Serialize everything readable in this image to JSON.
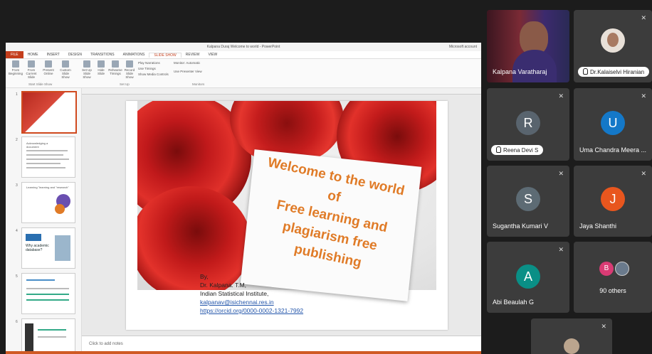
{
  "powerpoint": {
    "window_title": "Kalpana Duraj Welcome to world - PowerPoint",
    "account": "Microsoft account",
    "tabs": [
      "FILE",
      "HOME",
      "INSERT",
      "DESIGN",
      "TRANSITIONS",
      "ANIMATIONS",
      "SLIDE SHOW",
      "REVIEW",
      "VIEW"
    ],
    "ribbon": {
      "from_beginning": "From Beginning",
      "from_current": "From Current Slide",
      "present_online": "Present Online",
      "custom_show": "Custom Slide Show",
      "setup_show": "Set Up Slide Show",
      "hide_slide": "Hide Slide",
      "rehearse": "Rehearse Timings",
      "record": "Record Slide Show",
      "play_narrations": "Play Narrations",
      "use_timings": "Use Timings",
      "show_media": "Show Media Controls",
      "monitor": "Monitor: Automatic",
      "presenter_view": "Use Presenter View",
      "group_start": "Start Slide Show",
      "group_setup": "Set Up",
      "group_monitors": "Monitors"
    },
    "thumbnails": [
      {
        "num": "1",
        "title": ""
      },
      {
        "num": "2",
        "title": "Acknowledging a document"
      },
      {
        "num": "3",
        "title": "Learning \"learning and \"research\""
      },
      {
        "num": "4",
        "title": "Why academic database?"
      },
      {
        "num": "5",
        "title": ""
      },
      {
        "num": "6",
        "title": ""
      }
    ],
    "notes_placeholder": "Click to add notes",
    "slide": {
      "welcome_lines": [
        "Welcome to the  world",
        "of",
        "Free learning and",
        "plagiarism free",
        "publishing"
      ],
      "credits": [
        "By,",
        "Dr. Kalpana. T.M,",
        "Indian Statistical Institute,"
      ],
      "email": "kalpanav@isichennai.res.in",
      "orcid": "https://orcid.org/0000-0002-1321-7992"
    }
  },
  "participants": [
    {
      "name": "Kalpana Varatharaj",
      "type": "video"
    },
    {
      "name": "Dr.Kalaiselvi Hiranian",
      "type": "photo",
      "hand": true,
      "muted": true
    },
    {
      "name": "Reena Devi S",
      "initial": "R",
      "color": "#59646e",
      "hand": true,
      "muted": true
    },
    {
      "name": "Uma Chandra Meera ...",
      "initial": "U",
      "color": "#1478c8",
      "muted": true
    },
    {
      "name": "Sugantha Kumari V",
      "initial": "S",
      "color": "#5d6b74",
      "muted": true
    },
    {
      "name": "Jaya Shanthi",
      "initial": "J",
      "color": "#e8561e",
      "muted": true
    },
    {
      "name": "Abi Beaulah G",
      "initial": "A",
      "color": "#0a8f86",
      "muted": true
    },
    {
      "name": "90 others",
      "initial": "B",
      "color": "#d93b74"
    }
  ],
  "colors": {
    "accent": "#c43e1c",
    "welcome_text": "#e07b27",
    "tile_bg": "#3c3c3c"
  }
}
